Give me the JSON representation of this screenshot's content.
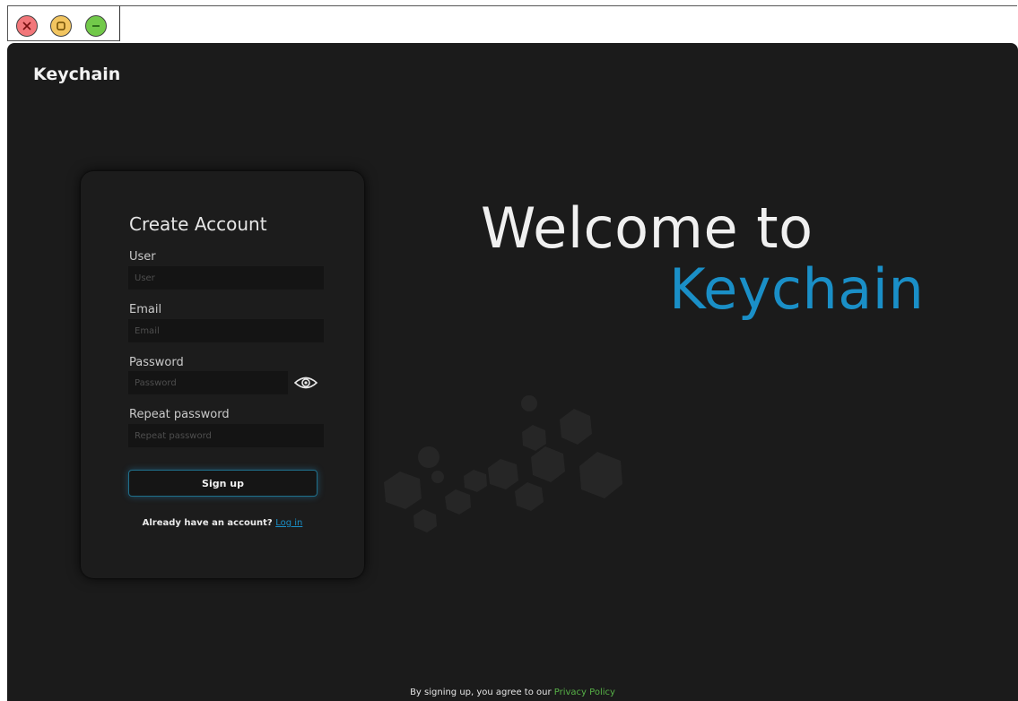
{
  "window": {
    "controls": [
      "close-icon",
      "maximize-icon",
      "minimize-icon"
    ],
    "control_colors": {
      "close": "#f2777a",
      "maximize": "#f2c560",
      "minimize": "#72c94a"
    }
  },
  "app": {
    "brand": "Keychain"
  },
  "form": {
    "title": "Create Account",
    "user": {
      "label": "User",
      "placeholder": "User"
    },
    "email": {
      "label": "Email",
      "placeholder": "Email"
    },
    "password": {
      "label": "Password",
      "placeholder": "Password",
      "toggle_icon": "eye-icon"
    },
    "repeat_password": {
      "label": "Repeat password",
      "placeholder": "Repeat password"
    },
    "signup_label": "Sign up",
    "have_account_text": "Already have an account?",
    "login_link": "Log in"
  },
  "hero": {
    "line1": "Welcome to",
    "line2": "Keychain",
    "accent_color": "#1a8fc7"
  },
  "footer": {
    "text": "By signing up, you agree to our",
    "link": "Privacy Policy",
    "link_color": "#57b247"
  }
}
